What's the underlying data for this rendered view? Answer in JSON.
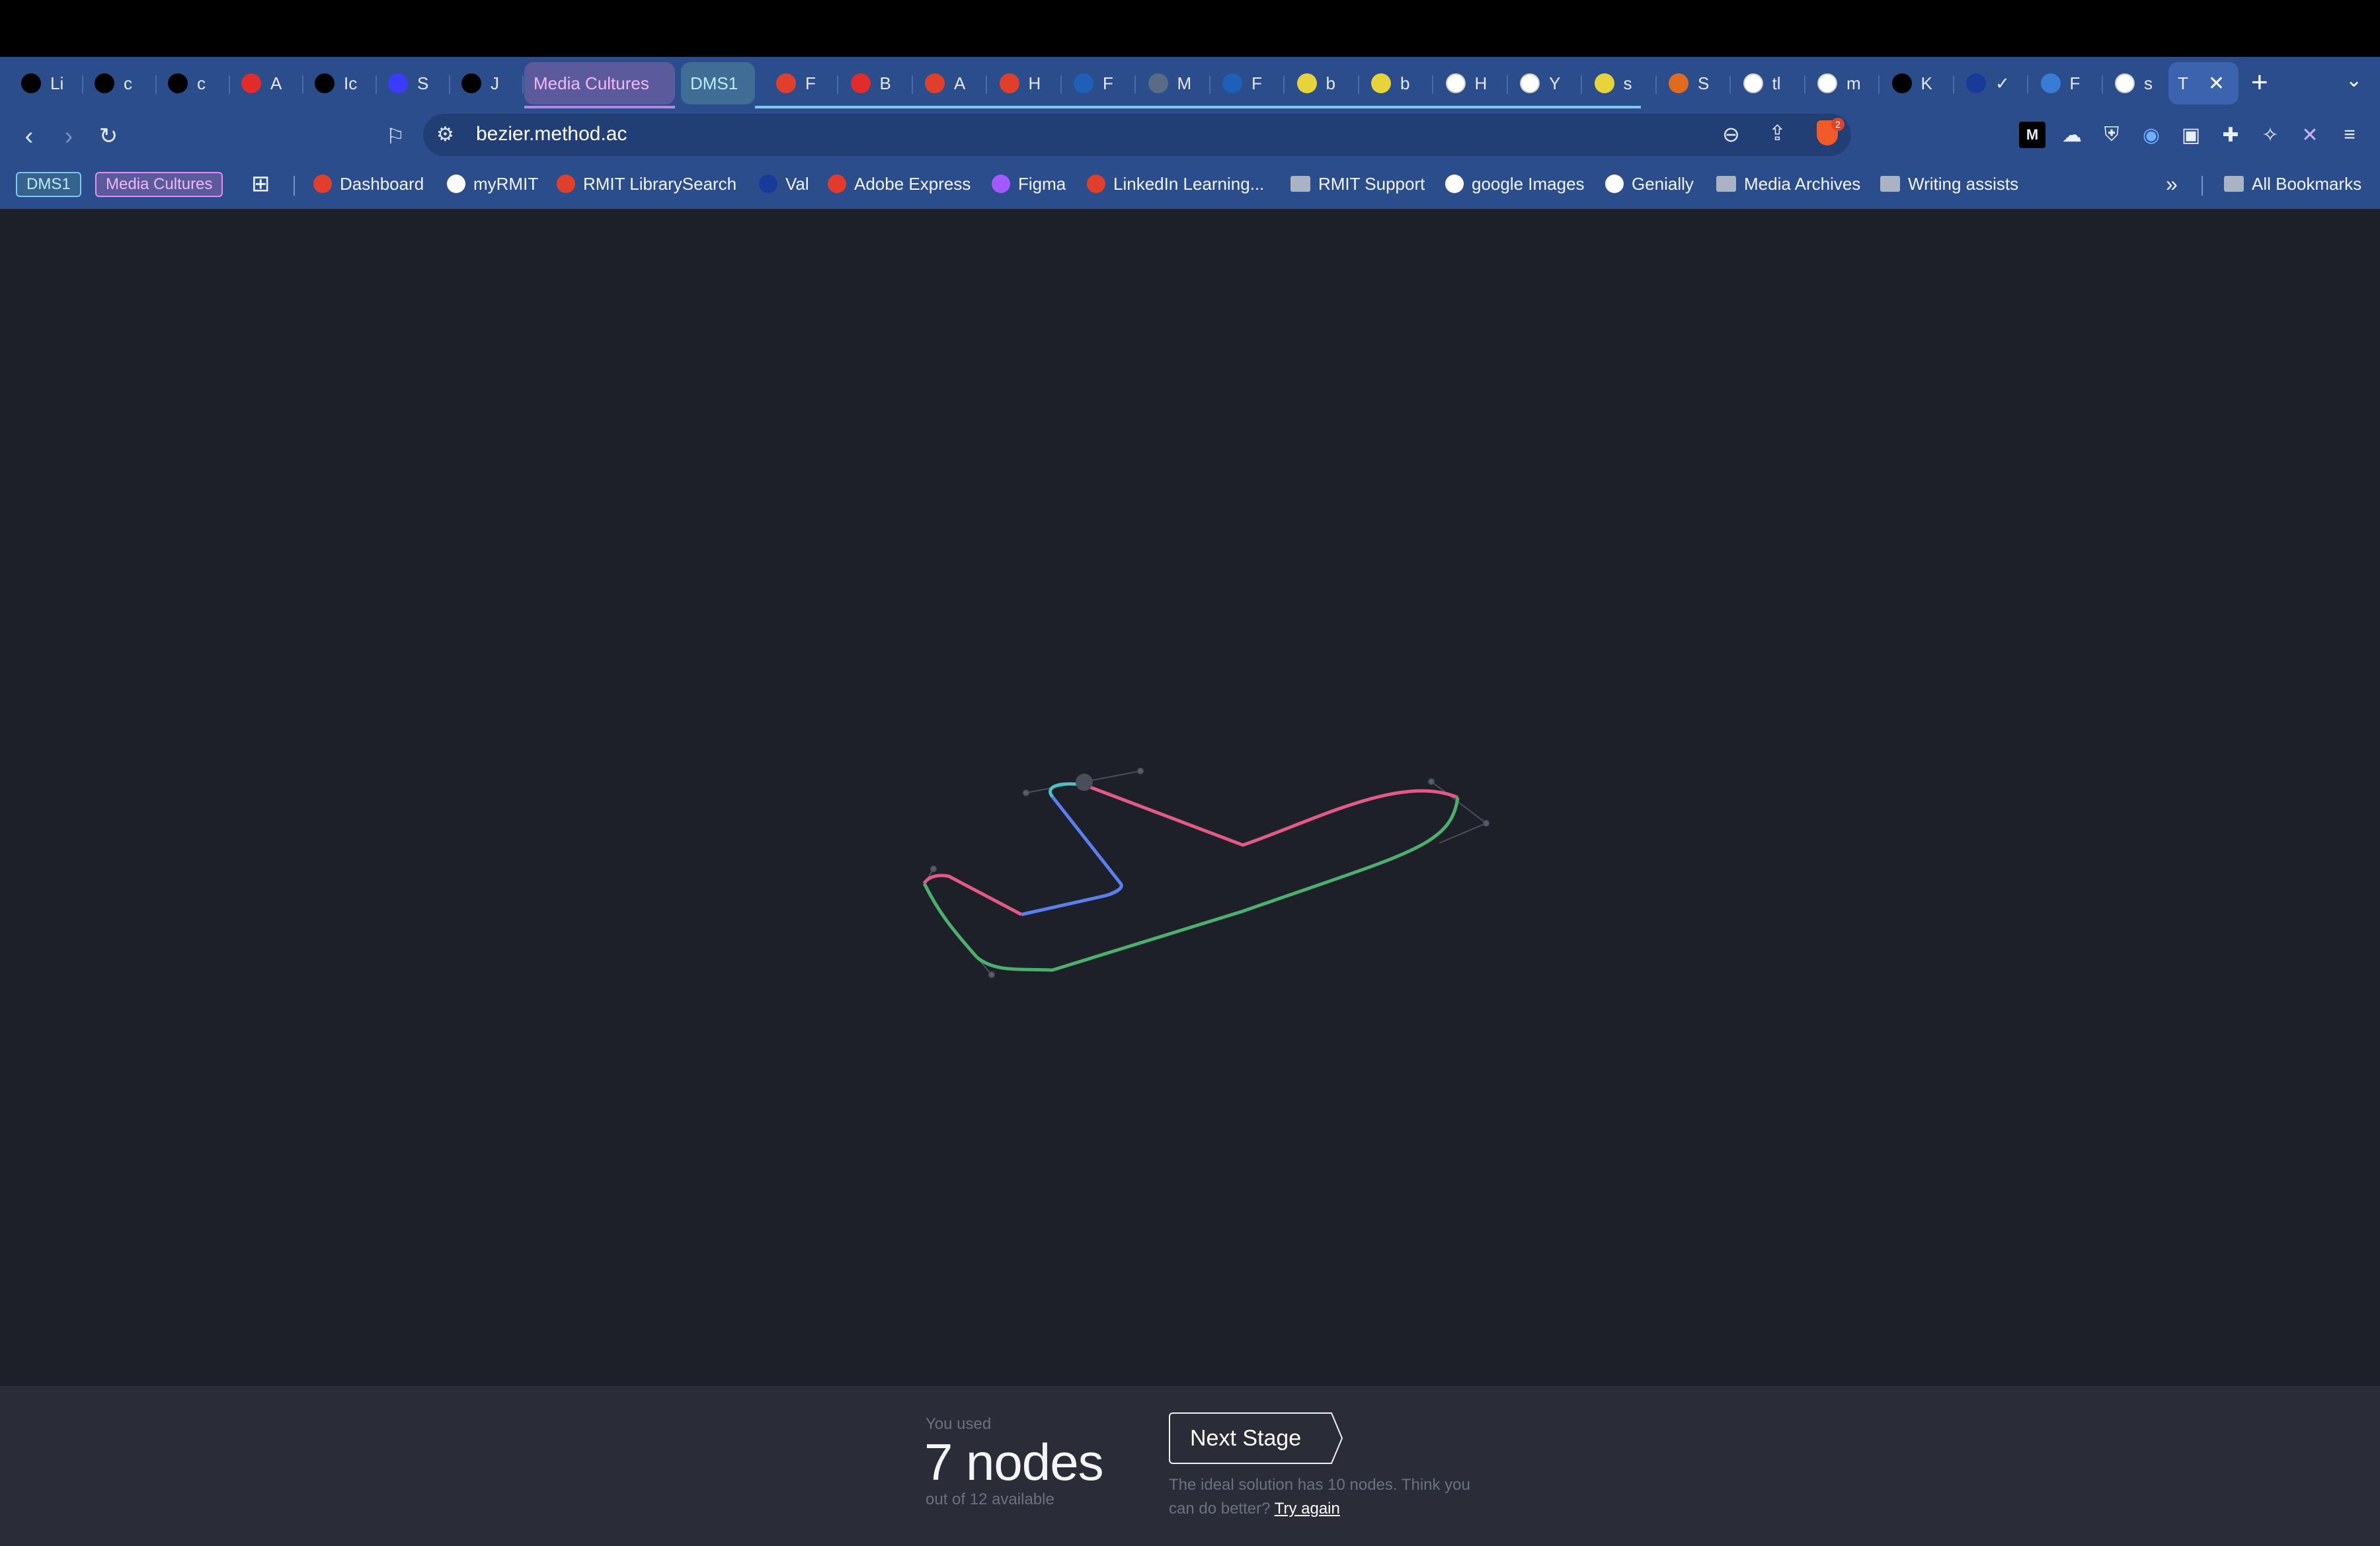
{
  "browser": {
    "tabs": [
      {
        "label": "Li",
        "icon": "perplexity-icon",
        "color": "#000000"
      },
      {
        "label": "c",
        "icon": "perplexity-icon",
        "color": "#000000"
      },
      {
        "label": "c",
        "icon": "perplexity-icon",
        "color": "#000000"
      },
      {
        "label": "A",
        "icon": "youtube-icon",
        "color": "#e22b2b"
      },
      {
        "label": "Ic",
        "icon": "perplexity-icon",
        "color": "#000000"
      },
      {
        "label": "S",
        "icon": "wave-icon",
        "color": "#3b3bff"
      },
      {
        "label": "J",
        "icon": "block-icon",
        "color": "#000000"
      }
    ],
    "group_media_cultures": "Media Cultures",
    "group_dms1": "DMS1",
    "tabs_after": [
      {
        "label": "F",
        "icon": "rmit-icon",
        "color": "#e0402b"
      },
      {
        "label": "B",
        "icon": "youtube-icon",
        "color": "#e22b2b"
      },
      {
        "label": "A",
        "icon": "rmit-icon",
        "color": "#e0402b"
      },
      {
        "label": "H",
        "icon": "rmit-icon",
        "color": "#e0402b"
      },
      {
        "label": "F",
        "icon": "mr-icon",
        "color": "#1f5fb8"
      },
      {
        "label": "M",
        "icon": "globe-icon",
        "color": "#5a6b86"
      },
      {
        "label": "F",
        "icon": "mr-icon",
        "color": "#1f5fb8"
      },
      {
        "label": "b",
        "icon": "lemon-icon",
        "color": "#e7d43a"
      },
      {
        "label": "b",
        "icon": "lemon-icon",
        "color": "#e7d43a"
      },
      {
        "label": "H",
        "icon": "pen-icon",
        "color": "#ffffff"
      },
      {
        "label": "Y",
        "icon": "github-icon",
        "color": "#ffffff"
      },
      {
        "label": "s",
        "icon": "lemon-icon",
        "color": "#e7d43a"
      },
      {
        "label": "S",
        "icon": "sc-icon",
        "color": "#e06b1f"
      },
      {
        "label": "tl",
        "icon": "google-icon",
        "color": "#ffffff"
      },
      {
        "label": "m",
        "icon": "google-icon",
        "color": "#ffffff"
      },
      {
        "label": "K",
        "icon": "black-flag-icon",
        "color": "#000000"
      },
      {
        "label": "✓",
        "icon": "moon-icon",
        "color": "#1a3a9a"
      },
      {
        "label": "F",
        "icon": "flag-icon",
        "color": "#3a7bd5"
      },
      {
        "label": "s",
        "icon": "google-icon",
        "color": "#ffffff"
      }
    ],
    "active_tab_label": "T",
    "url": "bezier.method.ac",
    "brave_badge": "2",
    "bookmarks": {
      "chip_dms1": "DMS1",
      "chip_media_cultures": "Media Cultures",
      "items": [
        {
          "label": "Dashboard",
          "type": "site",
          "color": "#e0402b"
        },
        {
          "label": "myRMIT",
          "type": "site",
          "color": "#ffffff"
        },
        {
          "label": "RMIT LibrarySearch",
          "type": "site",
          "color": "#e0402b"
        },
        {
          "label": "Val",
          "type": "site",
          "color": "#1a3a9a"
        },
        {
          "label": "Adobe Express",
          "type": "site",
          "color": "#e23b2b"
        },
        {
          "label": "Figma",
          "type": "site",
          "color": "#a259ff"
        },
        {
          "label": "LinkedIn Learning...",
          "type": "site",
          "color": "#e0402b"
        },
        {
          "label": "RMIT Support",
          "type": "folder"
        },
        {
          "label": "google Images",
          "type": "site",
          "color": "#ffffff"
        },
        {
          "label": "Genially",
          "type": "site",
          "color": "#ffffff"
        },
        {
          "label": "Media Archives",
          "type": "folder"
        },
        {
          "label": "Writing assists",
          "type": "folder"
        }
      ],
      "overflow": "»",
      "all_bookmarks": "All Bookmarks"
    }
  },
  "game": {
    "used_label": "You used",
    "used_count": "7 nodes",
    "available": "out of 12 available",
    "next_stage": "Next Stage",
    "hint": "The ideal solution has 10 nodes. Think you can do better?",
    "try_again": "Try again",
    "curve_colors": {
      "pink": "#e35a87",
      "green": "#4caf6e",
      "blue": "#5c7ff0",
      "teal": "#4dbfc6"
    }
  }
}
